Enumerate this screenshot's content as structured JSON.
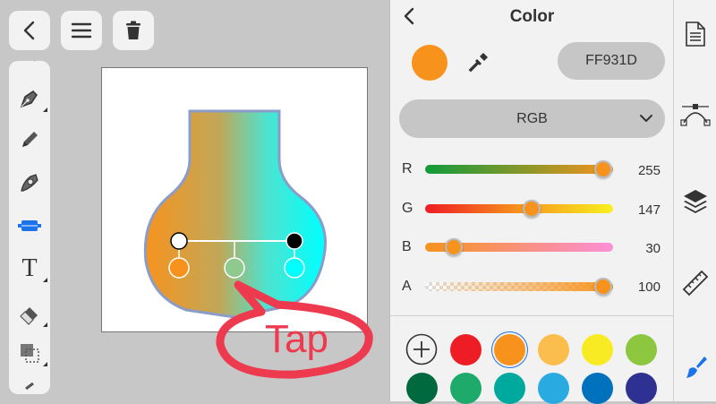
{
  "panel": {
    "title": "Color",
    "back_icon": "chevron-left-icon",
    "eyedropper_icon": "eyedropper-icon",
    "current_color": "#FF931D",
    "hex_value": "FF931D",
    "mode": "RGB",
    "sliders": [
      {
        "label": "R",
        "value": "255",
        "fraction": 1.0
      },
      {
        "label": "G",
        "value": "147",
        "fraction": 0.576
      },
      {
        "label": "B",
        "value": "30",
        "fraction": 0.118
      },
      {
        "label": "A",
        "value": "100",
        "fraction": 1.0
      }
    ],
    "swatches_row1": [
      "#ee1c25",
      "#f7931d",
      "#fbbd4b",
      "#f9eb23",
      "#8dc63f"
    ],
    "swatches_row2": [
      "#00693e",
      "#1daa6a",
      "#00a99d",
      "#29abe2",
      "#0071bc",
      "#2e3192"
    ]
  },
  "top_buttons": {
    "back": "chevron-left-icon",
    "menu": "hamburger-menu-icon",
    "delete": "trash-icon"
  },
  "tools": [
    "pen-nib-icon",
    "pencil-icon",
    "brush-icon",
    "shape-tool-icon",
    "text-tool-icon",
    "eraser-icon",
    "selection-icon"
  ],
  "tools_text_glyph": "T",
  "side_icons": [
    "document-icon",
    "bezier-curve-icon",
    "layers-icon",
    "ruler-icon",
    "paint-brush-icon"
  ],
  "annotation": {
    "text": "Tap"
  },
  "colors": {
    "accent": "#1a73e8",
    "annotation": "#ee3a4e",
    "gradient_left": "#f7931d",
    "gradient_right": "#00ffff"
  }
}
